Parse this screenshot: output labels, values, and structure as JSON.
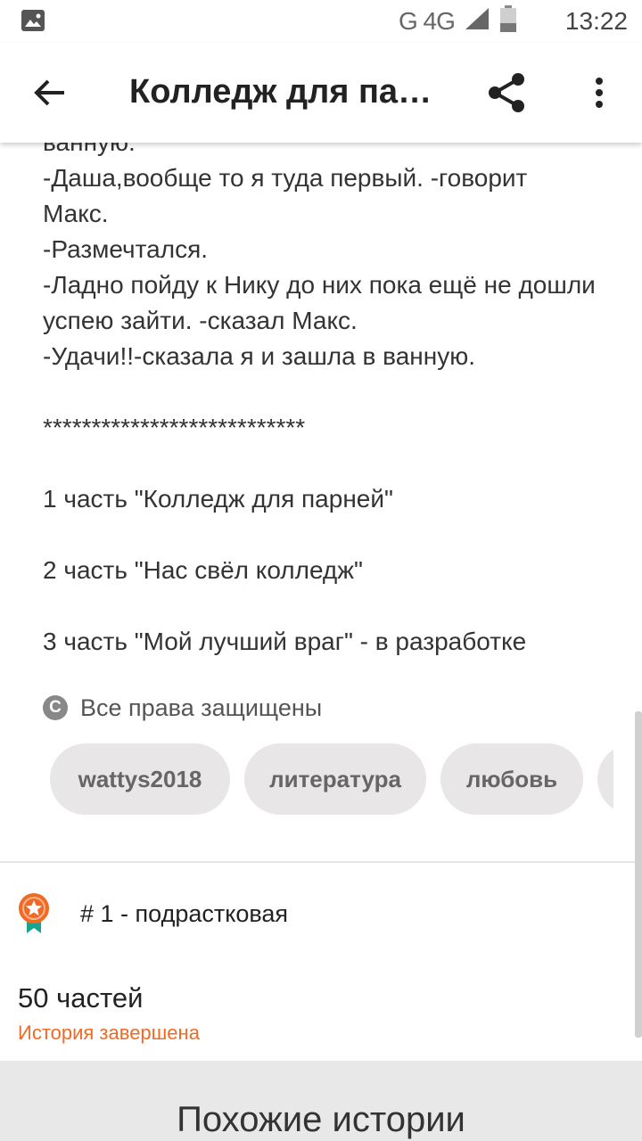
{
  "status_bar": {
    "network": "G 4G",
    "time": "13:22"
  },
  "appbar": {
    "title": "Колледж для па…"
  },
  "story": {
    "lines": [
      "ванную.",
      "-Даша,вообще то я туда первый. -говорит",
      "Макс.",
      "-Размечтался.",
      "-Ладно пойду к Нику до них пока ещё не дошли",
      "успею зайти. -сказал Макс.",
      "-Удачи!!-сказала я и зашла в ванную."
    ],
    "separator": "***************************",
    "parts_list": [
      "1 часть \"Колледж для парней\"",
      "2 часть \"Нас свёл колледж\"",
      "3 часть \"Мой лучший враг\" - в разработке"
    ]
  },
  "rights": {
    "icon_symbol": "C",
    "label": "Все права защищены"
  },
  "tags": [
    "wattys2018",
    "литература",
    "любовь",
    ""
  ],
  "rank": {
    "label": "# 1 - подрастковая"
  },
  "info": {
    "parts": "50 частей",
    "status": "История завершена"
  },
  "similar": {
    "title": "Похожие истории"
  },
  "colors": {
    "accent": "#f06a24",
    "badge": "#f06a24",
    "ribbon": "#1aa38f",
    "tag_bg": "#e8e6e6"
  }
}
